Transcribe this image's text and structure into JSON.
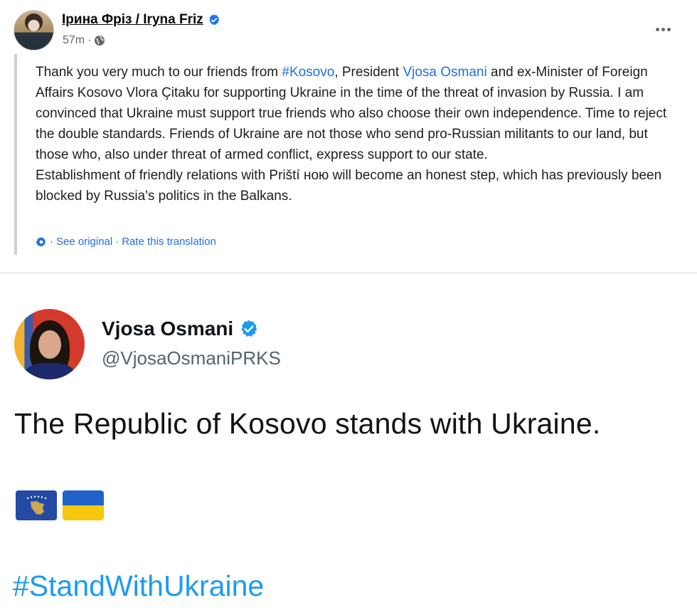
{
  "facebook_post": {
    "author_name": "Ірина Фріз / Iryna Friz",
    "timestamp": "57m",
    "privacy_icon": "globe-icon",
    "more_icon": "more-options-icon",
    "text": {
      "p1_before_kosovo": "Thank you very much to our friends from ",
      "kosovo_hashtag": "#Kosovo",
      "p1_between": ", President ",
      "osmani_link": "Vjosa Osmani",
      "p1_after": " and ex-Minister of Foreign Affairs Kosovo Vlora Çitaku for supporting Ukraine in the time of the threat of invasion by Russia. I am convinced that Ukraine must support true friends who also choose their own independence. Time to reject the double standards. Friends of Ukraine are not those who send pro-Russian militants to our land, but those who, also under threat of armed conflict, express support to our state.",
      "p2": "Establishment of friendly relations with Priští ною will become an honest step, which has previously been blocked by Russia's politics in the Balkans."
    },
    "translation": {
      "dot1": "·",
      "see_original": "See original",
      "dot2": "·",
      "rate_translation": "Rate this translation"
    }
  },
  "tweet": {
    "author_name": "Vjosa Osmani",
    "handle": "@VjosaOsmaniPRKS",
    "text": "The Republic of Kosovo stands with Ukraine.",
    "emoji_flags": [
      "kosovo-flag-icon",
      "ukraine-flag-icon"
    ],
    "hashtag": "#StandWithUkraine"
  },
  "colors": {
    "link_blue": "#216fdb",
    "twitter_blue": "#1d9bf0",
    "verified_blue": "#1877f2",
    "meta_gray": "#65676b",
    "handle_gray": "#536471"
  }
}
